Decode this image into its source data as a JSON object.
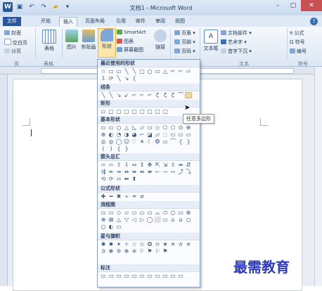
{
  "titlebar": {
    "title": "文档1 - Microsoft Word"
  },
  "tabs": [
    "文件",
    "开始",
    "插入",
    "页面布局",
    "引用",
    "邮件",
    "审阅",
    "视图"
  ],
  "ribbon": {
    "pages": {
      "cover": "封面",
      "blank": "空白页",
      "break": "分页",
      "label": "页"
    },
    "table": {
      "button": "表格",
      "label": "表格"
    },
    "illus": {
      "picture": "图片",
      "clipart": "剪贴画",
      "shapes": "形状",
      "smartart": "SmartArt",
      "chart": "图表",
      "screenshot": "屏幕截图"
    },
    "link": {
      "button": "链接"
    },
    "header": {
      "header": "页眉",
      "footer": "页脚",
      "pagenum": "页码"
    },
    "text": {
      "textbox": "文本框",
      "parts": "文档部件",
      "wordart": "艺术字",
      "dropcap": "首字下沉",
      "label": "文本"
    },
    "symbols": {
      "equation": "公式",
      "symbol": "符号",
      "number": "编号",
      "label": "符号"
    }
  },
  "dropdown": {
    "sections": [
      {
        "title": "最近使用的形状",
        "items": [
          "☆",
          "▭",
          "▭",
          "╲",
          "╲",
          "▢",
          "○",
          "▭",
          "△",
          "⌐",
          "⌐",
          "⇨",
          "⇩",
          "⟳",
          "╲",
          "↘",
          "{"
        ]
      },
      {
        "title": "线条",
        "items": [
          "╲",
          "╲",
          "↘",
          "↙",
          "⌐",
          "⌐",
          "⌐",
          "ζ",
          "ζ",
          "ζ",
          "⌒",
          "◌",
          "≀"
        ]
      },
      {
        "title": "矩形",
        "items": [
          "▭",
          "▢",
          "▢",
          "▢",
          "▢",
          "▢",
          "▢",
          "▢",
          "▢"
        ]
      },
      {
        "title": "基本形状",
        "items": [
          "▭",
          "▭",
          "○",
          "△",
          "◺",
          "▱",
          "▭",
          "◇",
          "⬠",
          "⬡",
          "⊙",
          "⊕",
          "⊕",
          "◐",
          "◔",
          "◑",
          "◕",
          "⌐",
          "◪",
          "▱",
          "◌",
          "▭",
          "▭",
          "▭",
          "◎",
          "◎",
          "◯",
          "☺",
          "♡",
          "☀",
          "☾",
          "❂",
          "▭",
          "⌒",
          "{",
          "}",
          "(",
          ")",
          "{",
          "}"
        ]
      },
      {
        "title": "箭头总汇",
        "items": [
          "⇨",
          "⇦",
          "⇧",
          "⇩",
          "⇔",
          "⇕",
          "✥",
          "⇱",
          "⇲",
          "⇳",
          "⇴",
          "⇵",
          "⇶",
          "⇷",
          "⇸",
          "⇹",
          "⇺",
          "⇻",
          "⇼",
          "⇽",
          "⇾",
          "⇿",
          "⤴",
          "⤵",
          "⟲",
          "⟳",
          "⬄",
          "⬅",
          "⬆"
        ]
      },
      {
        "title": "公式形状",
        "items": [
          "✚",
          "━",
          "✖",
          "÷",
          "═",
          "≠"
        ]
      },
      {
        "title": "流程图",
        "items": [
          "▭",
          "▭",
          "◇",
          "▱",
          "▭",
          "▭",
          "▭",
          "⌓",
          "⬭",
          "○",
          "▭",
          "⊗",
          "⊕",
          "⊠",
          "△",
          "▽",
          "◁",
          "▷",
          "◯",
          "⬜",
          "▭",
          "⌂",
          "⌂",
          "○",
          "○",
          "◐",
          "▭"
        ]
      },
      {
        "title": "星与旗帜",
        "items": [
          "✺",
          "✹",
          "✦",
          "✧",
          "☆",
          "✩",
          "✪",
          "✫",
          "✬",
          "✭",
          "✮",
          "✯",
          "✰",
          "❋",
          "❊",
          "❉",
          "❈",
          "⚐",
          "⚑",
          "⚐",
          "⚑"
        ]
      },
      {
        "title": "标注",
        "items": [
          "▭",
          "▭",
          "▭",
          "▭",
          "▭",
          "▭",
          "▭",
          "▭",
          "▭",
          "▭",
          "▭"
        ]
      }
    ]
  },
  "tooltip": "任意多边形",
  "watermark": "最需教育"
}
